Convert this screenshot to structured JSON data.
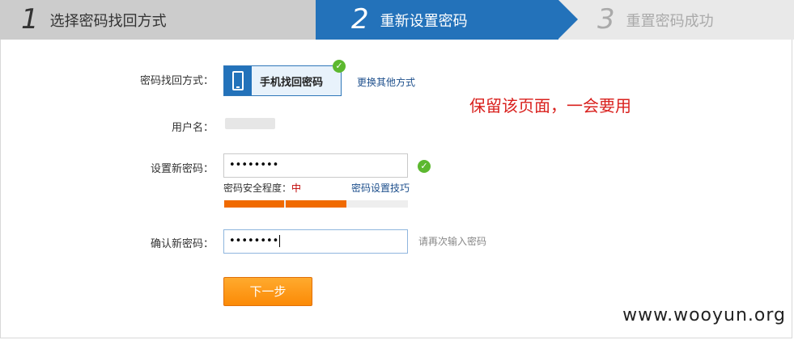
{
  "steps": [
    {
      "num": "1",
      "label": "选择密码找回方式",
      "state": "done"
    },
    {
      "num": "2",
      "label": "重新设置密码",
      "state": "active"
    },
    {
      "num": "3",
      "label": "重置密码成功",
      "state": "pending"
    }
  ],
  "colors": {
    "active_step": "#2372ba",
    "done_step": "#cccccc",
    "button": "#fb8a06",
    "strength": "#f06a00",
    "note": "#d9201d"
  },
  "form": {
    "method_label": "密码找回方式：",
    "method_name": "手机找回密码",
    "change_method_link": "更换其他方式",
    "username_label": "用户名：",
    "new_password_label": "设置新密码：",
    "new_password_value": "••••••••",
    "strength_label": "密码安全程度：",
    "strength_level": "中",
    "strength_fraction": 0.67,
    "tips_link": "密码设置技巧",
    "confirm_label": "确认新密码：",
    "confirm_value": "••••••••",
    "confirm_hint": "请再次输入密码",
    "next_button": "下一步"
  },
  "note": "保留该页面，一会要用",
  "watermark": "www.wooyun.org",
  "icons": {
    "method": "phone-icon",
    "ok": "check-circle-icon"
  }
}
